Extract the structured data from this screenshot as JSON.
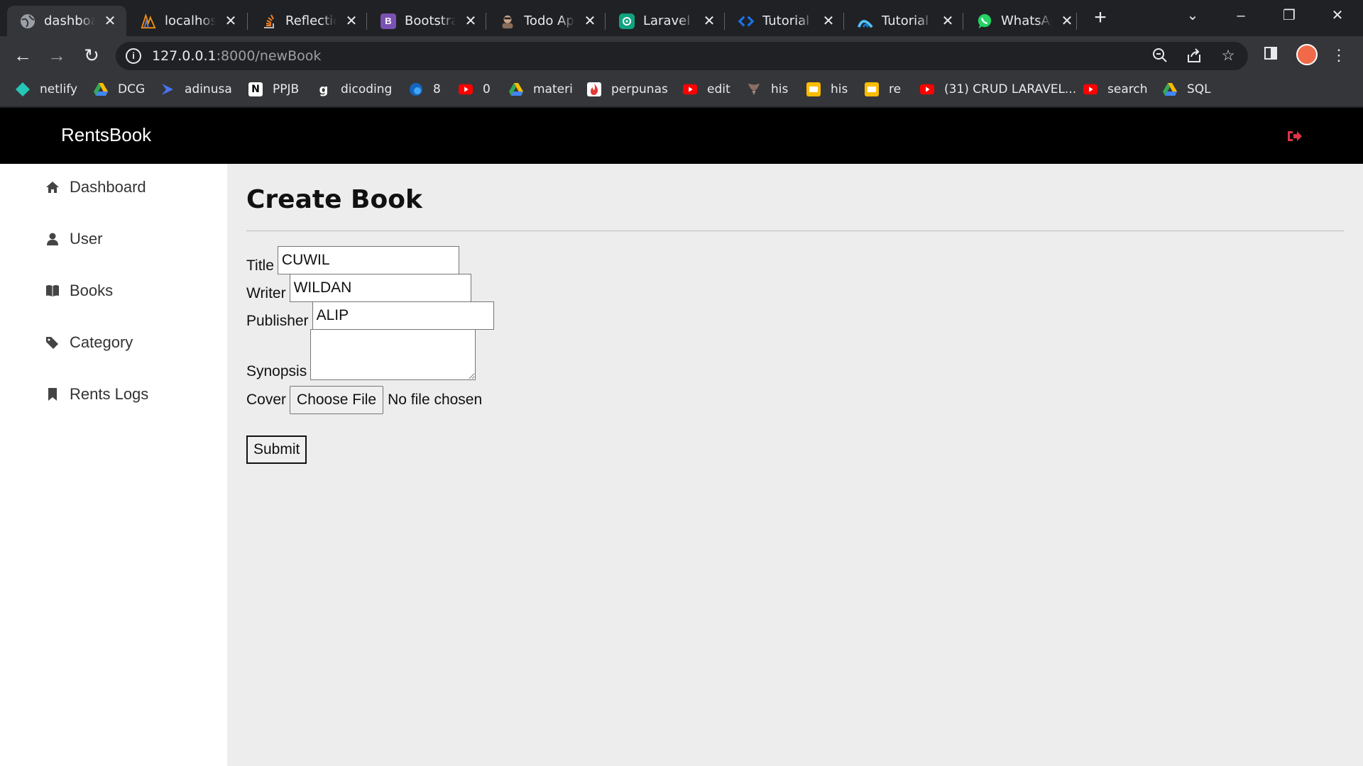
{
  "browser": {
    "tabs": [
      {
        "title": "dashboard",
        "icon": "globe-icon",
        "color": "#5f6368",
        "active": true
      },
      {
        "title": "localhost",
        "icon": "phpmyadmin-icon",
        "color": "#f29111"
      },
      {
        "title": "Reflection",
        "icon": "stackoverflow-icon",
        "color": "#f48024"
      },
      {
        "title": "Bootstrap",
        "icon": "bootstrap-icon",
        "color": "#7952b3"
      },
      {
        "title": "Todo App",
        "icon": "avatar-icon",
        "color": "#8a6d5a"
      },
      {
        "title": "Laravel r",
        "icon": "chatgpt-icon",
        "color": "#10a37f"
      },
      {
        "title": "Tutorial",
        "icon": "code-icon",
        "color": "#1a73e8"
      },
      {
        "title": "Tutorial",
        "icon": "arc-icon",
        "color": "#4fc3f7"
      },
      {
        "title": "WhatsApp",
        "icon": "whatsapp-icon",
        "color": "#25d366"
      }
    ],
    "address": {
      "host": "127.0.0.1",
      "path": ":8000/newBook"
    },
    "bookmarks": [
      {
        "label": "netlify",
        "icon": "netlify-icon",
        "color": "#25c7b7"
      },
      {
        "label": "DCG",
        "icon": "drive-icon",
        "color": "#fbbc04"
      },
      {
        "label": "adinusa",
        "icon": "adinusa-icon",
        "color": "#4a73f5"
      },
      {
        "label": "PPJB",
        "icon": "notion-icon",
        "color": "#ffffff"
      },
      {
        "label": "dicoding",
        "icon": "dicoding-icon",
        "color": "#35363a"
      },
      {
        "label": "8",
        "icon": "edge-icon",
        "color": "#1565c0"
      },
      {
        "label": "0",
        "icon": "youtube-icon",
        "color": "#ff0000"
      },
      {
        "label": "materi",
        "icon": "drive-icon",
        "color": "#34a853"
      },
      {
        "label": "perpunas",
        "icon": "fire-icon",
        "color": "#ffffff"
      },
      {
        "label": "edit",
        "icon": "youtube-icon",
        "color": "#ff0000"
      },
      {
        "label": "his",
        "icon": "garuda-icon",
        "color": "#8d6e63"
      },
      {
        "label": "his",
        "icon": "slides-icon",
        "color": "#fbbc04"
      },
      {
        "label": "re",
        "icon": "slides-icon",
        "color": "#fbbc04"
      },
      {
        "label": "(31) CRUD LARAVEL...",
        "icon": "youtube-icon",
        "color": "#ff0000"
      },
      {
        "label": "search",
        "icon": "youtube-icon",
        "color": "#ff0000"
      },
      {
        "label": "SQL",
        "icon": "drive-icon",
        "color": "#34a853"
      }
    ]
  },
  "app": {
    "brand": "RentsBook",
    "sidebar": [
      {
        "label": "Dashboard",
        "icon": "home-icon"
      },
      {
        "label": "User",
        "icon": "user-icon"
      },
      {
        "label": "Books",
        "icon": "book-icon"
      },
      {
        "label": "Category",
        "icon": "tags-icon"
      },
      {
        "label": "Rents Logs",
        "icon": "bookmark-icon"
      }
    ],
    "page_title": "Create Book",
    "form": {
      "title_label": "Title",
      "title_value": "CUWIL",
      "writer_label": "Writer",
      "writer_value": "WILDAN",
      "publisher_label": "Publisher",
      "publisher_value": "ALIP",
      "synopsis_label": "Synopsis",
      "synopsis_value": "",
      "cover_label": "Cover",
      "file_button": "Choose File",
      "file_status": "No file chosen",
      "submit": "Submit"
    },
    "colors": {
      "appbar": "#000000",
      "logout": "#dc3545",
      "content_bg": "#ededed"
    }
  }
}
